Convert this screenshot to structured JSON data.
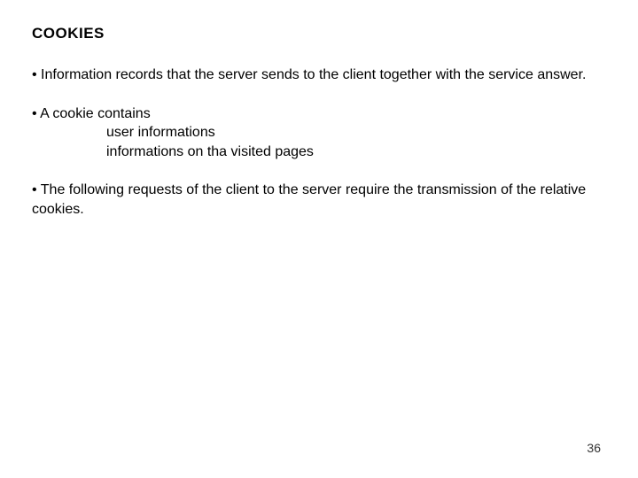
{
  "title": "COOKIES",
  "p1": {
    "lead": "Information records that the server sends to the client together with the service answer."
  },
  "p2": {
    "lead": "A cookie contains",
    "sub1": "user informations",
    "sub2": "informations on tha visited pages"
  },
  "p3": {
    "lead": "The following requests of the client to the server require the transmission of the relative cookies."
  },
  "page_number": "36"
}
